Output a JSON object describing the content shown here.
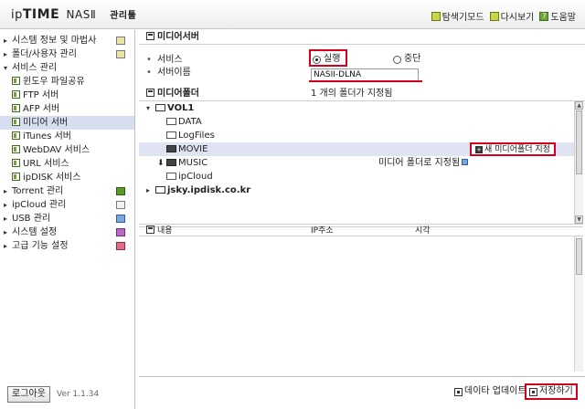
{
  "app": {
    "logo_ip": "ip",
    "logo_time": "TIME",
    "logo_nas": "NASⅡ",
    "logo_sub": "관리툴"
  },
  "toplinks": [
    {
      "label": "탐색기모드"
    },
    {
      "label": "다시보기"
    },
    {
      "label": "도움말"
    }
  ],
  "sidebar": {
    "menu": [
      {
        "label": "시스템 정보 및 마법사"
      },
      {
        "label": "폴더/사용자 관리"
      },
      {
        "label": "서비스 관리"
      },
      {
        "label": "윈도우 파일공유"
      },
      {
        "label": "FTP 서버"
      },
      {
        "label": "AFP 서버"
      },
      {
        "label": "미디어 서버"
      },
      {
        "label": "iTunes 서버"
      },
      {
        "label": "WebDAV 서비스"
      },
      {
        "label": "URL 서비스"
      },
      {
        "label": "ipDISK 서비스"
      },
      {
        "label": "Torrent 관리"
      },
      {
        "label": "ipCloud 관리"
      },
      {
        "label": "USB 관리"
      },
      {
        "label": "시스템 설정"
      },
      {
        "label": "고급 기능 설정"
      }
    ],
    "logout": "로그아웃",
    "version": "Ver 1.1.34"
  },
  "media_server": {
    "title": "미디어서버",
    "service_label": "서비스",
    "name_label": "서버이름",
    "radio_run": "실행",
    "radio_stop": "중단",
    "server_name": "NASII-DLNA"
  },
  "media_folder": {
    "title": "미디어폴더",
    "summary": "1 개의 폴더가 지정됨",
    "tree": [
      {
        "label": "VOL1"
      },
      {
        "label": "DATA"
      },
      {
        "label": "LogFiles"
      },
      {
        "label": "MOVIE"
      },
      {
        "label": "MUSIC"
      },
      {
        "label": "ipCloud"
      },
      {
        "label": "jsky.ipdisk.co.kr"
      }
    ],
    "add_button": "새 미디어폴더 지정",
    "assigned_text": "미디어 폴더로 지정됨"
  },
  "table": {
    "headers": [
      "내용",
      "IP주소",
      "시각"
    ]
  },
  "footer": {
    "update_button": "데이타 업데이트",
    "save_button": "저장하기"
  },
  "colors": {
    "highlight_red": "#d6001c",
    "selected_row": "#dfe3f2",
    "active_menu": "#d7def0"
  }
}
